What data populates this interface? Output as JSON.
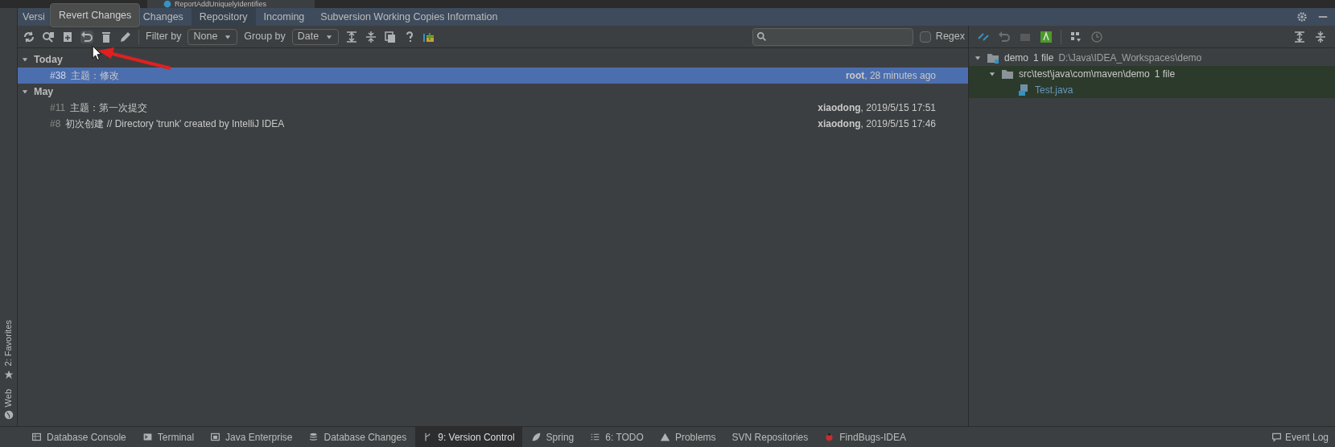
{
  "editor_tab": {
    "label": "ReportAddUniquelyIdentifies"
  },
  "tool_window": {
    "tabs": [
      {
        "label": "Versi",
        "selected": false
      },
      {
        "label": "Changes",
        "selected": false
      },
      {
        "label": "Repository",
        "selected": true
      },
      {
        "label": "Incoming",
        "selected": false
      },
      {
        "label": "Subversion Working Copies Information",
        "selected": false
      }
    ],
    "tooltip": "Revert Changes",
    "filter_by": {
      "label": "Filter by",
      "value": "None"
    },
    "group_by": {
      "label": "Group by",
      "value": "Date"
    },
    "regex": {
      "label": "Regex",
      "checked": false
    }
  },
  "groups": [
    {
      "label": "Today",
      "expanded": true,
      "rows": [
        {
          "number": "#38",
          "message": "主题：修改",
          "meta": "**root**, 28 minutes ago",
          "selected": true
        }
      ]
    },
    {
      "label": "May",
      "expanded": true,
      "rows": [
        {
          "number": "#11",
          "message": "主题：第一次提交",
          "meta": "**xiaodong**, 2019/5/15 17:51",
          "selected": false
        },
        {
          "number": "#8",
          "message": "初次创建 // Directory 'trunk' created by IntelliJ IDEA",
          "meta": "**xiaodong**, 2019/5/15 17:46",
          "selected": false
        }
      ]
    }
  ],
  "changes": [
    {
      "kind": "module",
      "name": "demo",
      "count": "1 file",
      "path": "D:\\Java\\IDEA_Workspaces\\demo",
      "expanded": true,
      "highlighted": false,
      "children": [
        {
          "kind": "folder",
          "name": "src\\test\\java\\com\\maven\\demo",
          "count": "1 file",
          "expanded": true,
          "highlighted": true,
          "children": [
            {
              "kind": "file",
              "name": "Test.java",
              "highlighted": true
            }
          ]
        }
      ]
    }
  ],
  "left_strip": [
    "2: Favorites",
    "Web"
  ],
  "bottom_tabs": [
    {
      "label": "Database Console",
      "selected": false
    },
    {
      "label": "Terminal",
      "selected": false
    },
    {
      "label": "Java Enterprise",
      "selected": false
    },
    {
      "label": "Database Changes",
      "selected": false
    },
    {
      "label": "9: Version Control",
      "selected": true
    },
    {
      "label": "Spring",
      "selected": false
    },
    {
      "label": "6: TODO",
      "selected": false
    },
    {
      "label": "Problems",
      "selected": false
    },
    {
      "label": "SVN Repositories",
      "selected": false
    },
    {
      "label": "FindBugs-IDEA",
      "selected": false
    }
  ],
  "event_log": "Event Log"
}
